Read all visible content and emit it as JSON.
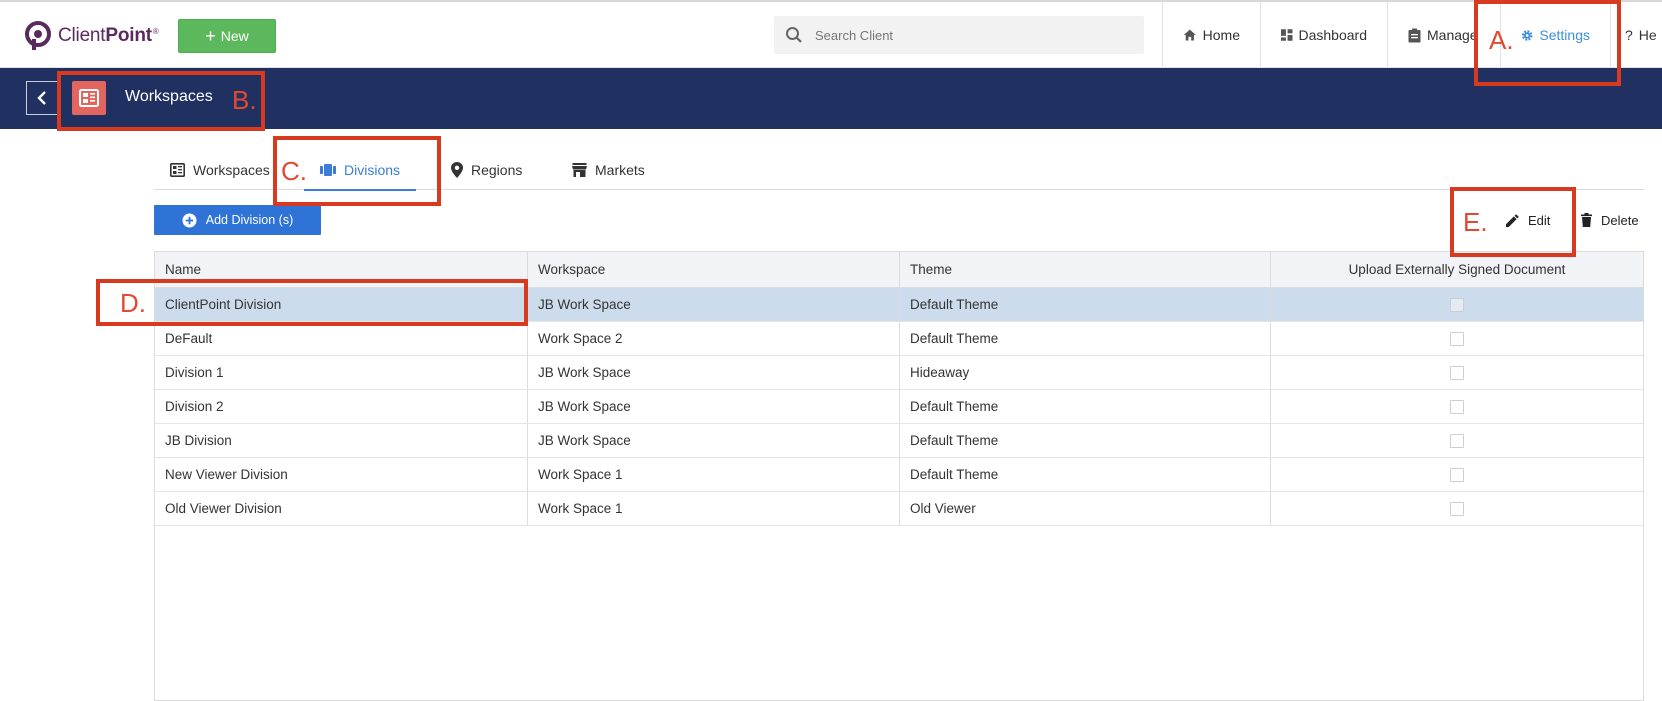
{
  "header": {
    "logo_text_regular": "Client",
    "logo_text_bold": "Point",
    "logo_mark": "®",
    "new_button": {
      "plus": "+",
      "label": "New"
    },
    "search": {
      "placeholder": "Search Client",
      "value": ""
    },
    "nav": [
      {
        "label": "Home",
        "icon": "home-icon"
      },
      {
        "label": "Dashboard",
        "icon": "dashboard-icon"
      },
      {
        "label": "Manage",
        "icon": "clipboard-icon"
      },
      {
        "label": "Settings",
        "icon": "gear-icon",
        "active": true
      },
      {
        "label": "He",
        "icon": "help-icon",
        "prefix": "?"
      }
    ],
    "active_color": "#3b8fde"
  },
  "band": {
    "title": "Workspaces",
    "background": "#1f3061",
    "icon_color": "#e2665f"
  },
  "tabs": [
    {
      "label": "Workspaces",
      "icon": "workspace-icon"
    },
    {
      "label": "Divisions",
      "icon": "divisions-icon",
      "active": true
    },
    {
      "label": "Regions",
      "icon": "location-pin-icon"
    },
    {
      "label": "Markets",
      "icon": "store-icon"
    }
  ],
  "toolbar": {
    "add_label": "Add Division (s)",
    "edit_label": "Edit",
    "delete_label": "Delete"
  },
  "grid": {
    "columns": [
      "Name",
      "Workspace",
      "Theme",
      "Upload Externally Signed Document"
    ],
    "rows": [
      {
        "name": "ClientPoint Division",
        "workspace": "JB Work Space",
        "theme": "Default Theme",
        "upload": false,
        "selected": true
      },
      {
        "name": "DeFault",
        "workspace": "Work Space 2",
        "theme": "Default Theme",
        "upload": false
      },
      {
        "name": "Division 1",
        "workspace": "JB Work Space",
        "theme": "Hideaway",
        "upload": false
      },
      {
        "name": "Division 2",
        "workspace": "JB Work Space",
        "theme": "Default Theme",
        "upload": false
      },
      {
        "name": "JB Division",
        "workspace": "JB Work Space",
        "theme": "Default Theme",
        "upload": false
      },
      {
        "name": "New Viewer Division",
        "workspace": "Work Space 1",
        "theme": "Default Theme",
        "upload": false
      },
      {
        "name": "Old Viewer Division",
        "workspace": "Work Space 1",
        "theme": "Old Viewer",
        "upload": false
      }
    ]
  },
  "annotations": {
    "a": "A.",
    "b": "B.",
    "c": "C.",
    "d": "D.",
    "e": "E.",
    "color": "#d83a20"
  }
}
